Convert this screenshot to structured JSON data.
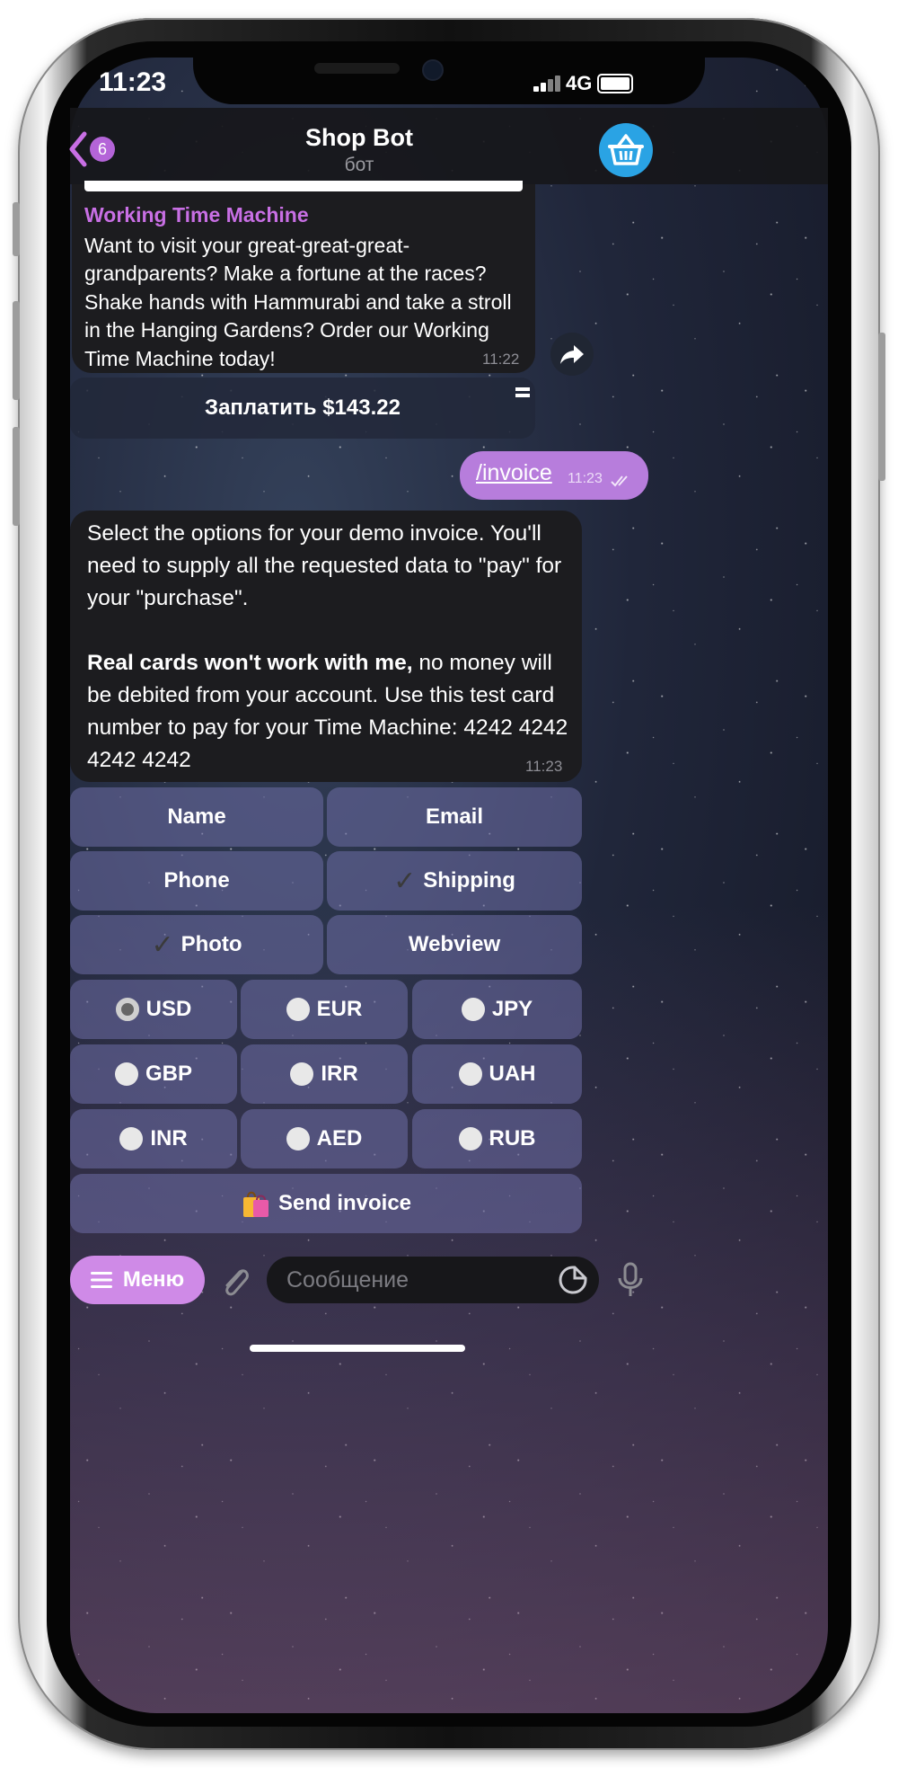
{
  "status": {
    "time": "11:23",
    "network": "4G"
  },
  "header": {
    "title": "Shop Bot",
    "subtitle": "бот",
    "unread_count": "6"
  },
  "messages": {
    "product": {
      "title": "Working Time Machine",
      "description": "Want to visit your great-great-great-grandparents? Make a fortune at the races? Shake hands with Hammurabi and take a stroll in the Hanging Gardens? Order our Working Time Machine today!",
      "time": "11:22",
      "pay_button": "Заплатить $143.22"
    },
    "outgoing": {
      "text": "/invoice",
      "time": "11:23"
    },
    "bot_reply": {
      "line1": "Select the options for your demo invoice. You'll need to supply all the requested data to \"pay\" for your \"purchase\".",
      "bold": "Real cards won't work with me,",
      "line2": " no money will be debited from your account. Use this test card number to pay for your Time Machine: 4242  4242  4242  4242",
      "time": "11:23"
    }
  },
  "keyboard": {
    "options": [
      {
        "label": "Name",
        "checked": false
      },
      {
        "label": "Email",
        "checked": false
      },
      {
        "label": "Phone",
        "checked": false
      },
      {
        "label": "Shipping",
        "checked": true
      },
      {
        "label": "Photo",
        "checked": true
      },
      {
        "label": "Webview",
        "checked": false
      }
    ],
    "currencies": [
      {
        "label": "USD",
        "selected": true
      },
      {
        "label": "EUR",
        "selected": false
      },
      {
        "label": "JPY",
        "selected": false
      },
      {
        "label": "GBP",
        "selected": false
      },
      {
        "label": "IRR",
        "selected": false
      },
      {
        "label": "UAH",
        "selected": false
      },
      {
        "label": "INR",
        "selected": false
      },
      {
        "label": "AED",
        "selected": false
      },
      {
        "label": "RUB",
        "selected": false
      }
    ],
    "send_button": "Send invoice"
  },
  "input_bar": {
    "menu_label": "Меню",
    "placeholder": "Сообщение"
  },
  "icons": {
    "back": "chevron-left-icon",
    "basket": "basket-icon",
    "share": "share-icon",
    "attach": "paperclip-icon",
    "sticker": "sticker-icon",
    "mic": "microphone-icon",
    "shopping": "shopping-bags-icon"
  },
  "colors": {
    "accent": "#c86fe4",
    "basket": "#2aa3e4",
    "outgoing_bubble": "#b77ddc",
    "menu_button": "#cf8ae7"
  }
}
